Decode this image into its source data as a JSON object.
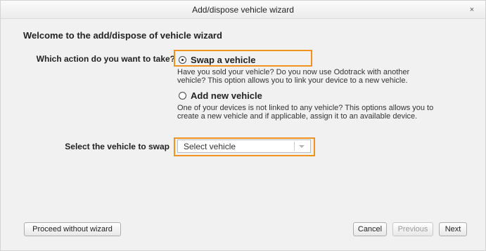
{
  "dialog": {
    "title": "Add/dispose vehicle wizard",
    "close_label": "×"
  },
  "heading": "Welcome to the add/dispose of vehicle wizard",
  "action": {
    "label": "Which action do you want to take?",
    "options": [
      {
        "title": "Swap a vehicle",
        "selected": true,
        "description": "Have you sold your vehicle? Do you now use Odotrack with another vehicle? This option allows you to link your device to a new vehicle."
      },
      {
        "title": "Add new vehicle",
        "selected": false,
        "description": "One of your devices is not linked to any vehicle? This options allows you to create a new vehicle and if applicable, assign it to an available device."
      }
    ]
  },
  "vehicle": {
    "label": "Select the vehicle to swap",
    "selected_value": "Select vehicle"
  },
  "buttons": {
    "proceed": "Proceed without wizard",
    "cancel": "Cancel",
    "previous": "Previous",
    "next": "Next"
  },
  "colors": {
    "highlight": "#f0921d",
    "background": "#f1f1f1"
  },
  "icons": {
    "close": "close-icon",
    "dropdown": "chevron-down-icon"
  }
}
